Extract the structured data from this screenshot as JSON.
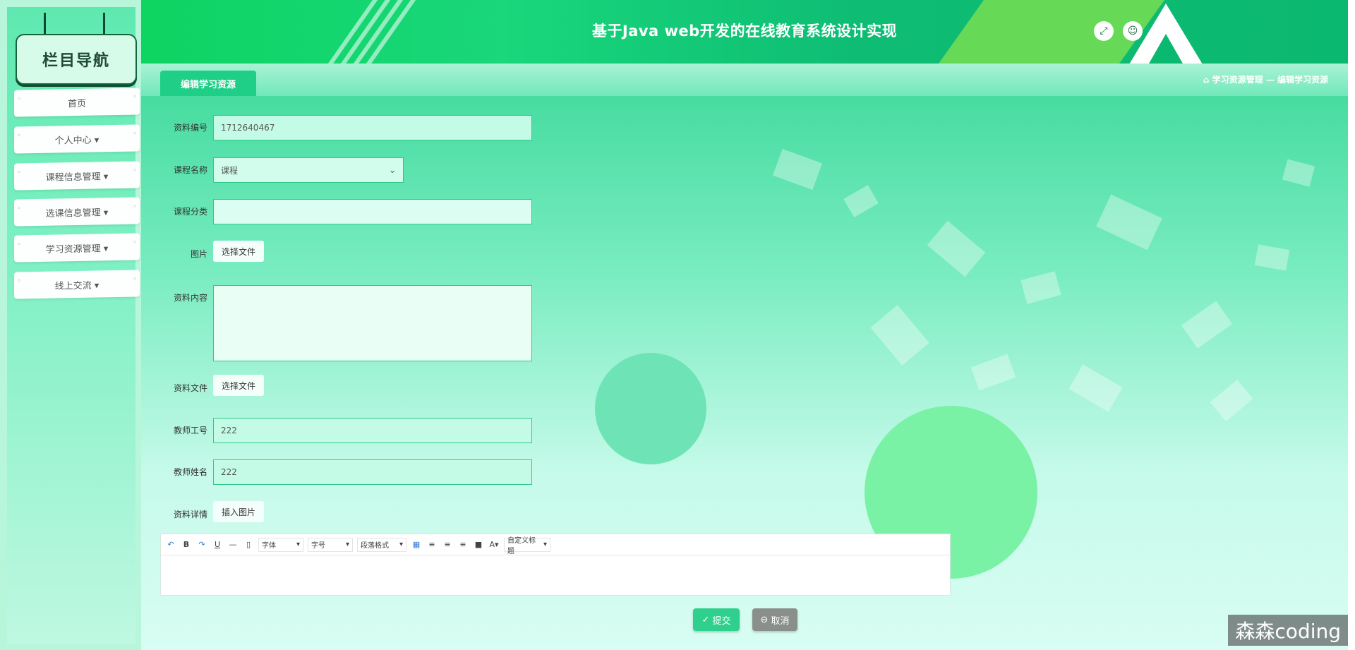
{
  "header": {
    "title": "基于Java web开发的在线教育系统设计实现",
    "fullscreen_icon": "expand-icon",
    "user_icon": "user-icon"
  },
  "sidebar": {
    "title": "栏目导航",
    "items": [
      {
        "label": "首页"
      },
      {
        "label": "个人中心 ▾"
      },
      {
        "label": "课程信息管理 ▾"
      },
      {
        "label": "选课信息管理 ▾"
      },
      {
        "label": "学习资源管理 ▾"
      },
      {
        "label": "线上交流 ▾"
      }
    ]
  },
  "tab": {
    "label": "编辑学习资源"
  },
  "breadcrumb": {
    "text": "学习资源管理 — 编辑学习资源",
    "icon": "home-icon"
  },
  "form": {
    "resource_no": {
      "label": "资料编号",
      "value": "1712640467"
    },
    "course_name": {
      "label": "课程名称",
      "value": "课程"
    },
    "course_category": {
      "label": "课程分类",
      "value": ""
    },
    "image": {
      "label": "图片",
      "button": "选择文件"
    },
    "resource_content": {
      "label": "资料内容",
      "value": ""
    },
    "resource_file": {
      "label": "资料文件",
      "button": "选择文件"
    },
    "teacher_no": {
      "label": "教师工号",
      "value": "222"
    },
    "teacher_name": {
      "label": "教师姓名",
      "value": "222"
    },
    "resource_detail": {
      "label": "资料详情",
      "button": "插入图片"
    }
  },
  "editor": {
    "font": "字体",
    "size": "字号",
    "paragraph": "段落格式",
    "custom_title": "自定义标题"
  },
  "actions": {
    "submit": "提交",
    "cancel": "取消"
  },
  "watermark": "森森coding",
  "colors": {
    "accent": "#1fcf88",
    "header": "#0ed462",
    "submit": "#2fd08e",
    "cancel": "#8a8f8c"
  }
}
